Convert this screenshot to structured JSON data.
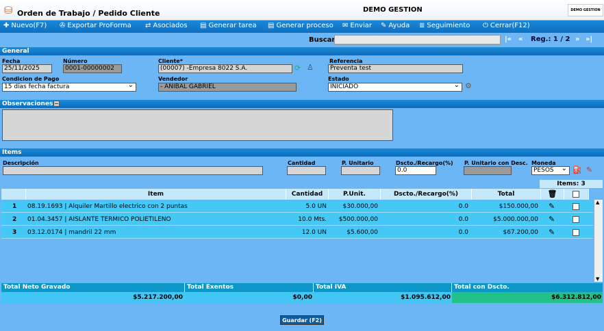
{
  "app": {
    "title": "Orden de Trabajo / Pedido Cliente",
    "company": "DEMO GESTION",
    "logo_text": "DEMO GESTION"
  },
  "toolbar": {
    "nuevo": "Nuevo(F7)",
    "exportar": "Exportar ProForma",
    "asociados": "Asociados",
    "generar_tarea": "Generar tarea",
    "generar_proceso": "Generar proceso",
    "enviar": "Enviar",
    "ayuda": "Ayuda",
    "seguimiento": "Seguimiento",
    "cerrar": "Cerrar(F12)"
  },
  "search": {
    "label": "Buscar",
    "value": "",
    "first": "|«",
    "prev": "«",
    "reg": "Reg.: 1 / 2",
    "next": "»",
    "last": "»|"
  },
  "general": {
    "section": "General",
    "fecha_label": "Fecha",
    "fecha": "25/11/2025",
    "numero_label": "Número",
    "numero": "0001-00000002",
    "cliente_label": "Cliente*",
    "cliente": "(00007) -Empresa 8022 S.A.",
    "referencia_label": "Referencia",
    "referencia": "Preventa test",
    "condicion_label": "Condicion de Pago",
    "condicion": "15 días fecha factura",
    "vendedor_label": "Vendedor",
    "vendedor": "- ANIBAL GABRIEL",
    "estado_label": "Estado",
    "estado": "INICIADO"
  },
  "observaciones": {
    "section": "Observaciones",
    "collapse": "−",
    "value": ""
  },
  "items": {
    "section": "Items",
    "descripcion_label": "Descripción",
    "cantidad_label": "Cantidad",
    "punitario_label": "P. Unitario",
    "dscto_label": "Dscto./Recargo(%)",
    "dscto_value": "0.0",
    "punitario_desc_label": "P. Unitario con Desc.",
    "moneda_label": "Moneda",
    "moneda": "PESOS",
    "count": "Items: 3"
  },
  "grid": {
    "headers": [
      "Item",
      "Cantidad",
      "P.Unit.",
      "Dscto./Recargo(%)",
      "Total"
    ],
    "rows": [
      {
        "n": "1",
        "item": "08.19.1693 | Alquiler Martillo electrico con 2 puntas",
        "cantidad": "5.0 UN",
        "punit": "$30.000,00",
        "dscto": "0.0",
        "total": "$150.000,00"
      },
      {
        "n": "2",
        "item": "01.04.3457 | AISLANTE TERMICO POLIETILENO",
        "cantidad": "10.0 Mts.",
        "punit": "$500.000,00",
        "dscto": "0.0",
        "total": "$5.000.000,00"
      },
      {
        "n": "3",
        "item": "03.12.0174 | mandril 22 mm",
        "cantidad": "12.0 UN",
        "punit": "$5.600,00",
        "dscto": "0.0",
        "total": "$67.200,00"
      }
    ]
  },
  "totals": {
    "neto_label": "Total Neto Gravado",
    "neto": "$5.217.200,00",
    "exentos_label": "Total Exentos",
    "exentos": "$0,00",
    "iva_label": "Total IVA",
    "iva": "$1.095.612,00",
    "con_dscto_label": "Total con Dscto.",
    "con_dscto": "$6.312.812,00"
  },
  "footer": {
    "guardar": "Guardar (F2)"
  },
  "colors": {
    "toolbar": "#1c88d8",
    "band": "#1b8cd9",
    "row": "#44c8f5",
    "total_highlight": "#22c08a",
    "save": "#0d5c9c"
  }
}
